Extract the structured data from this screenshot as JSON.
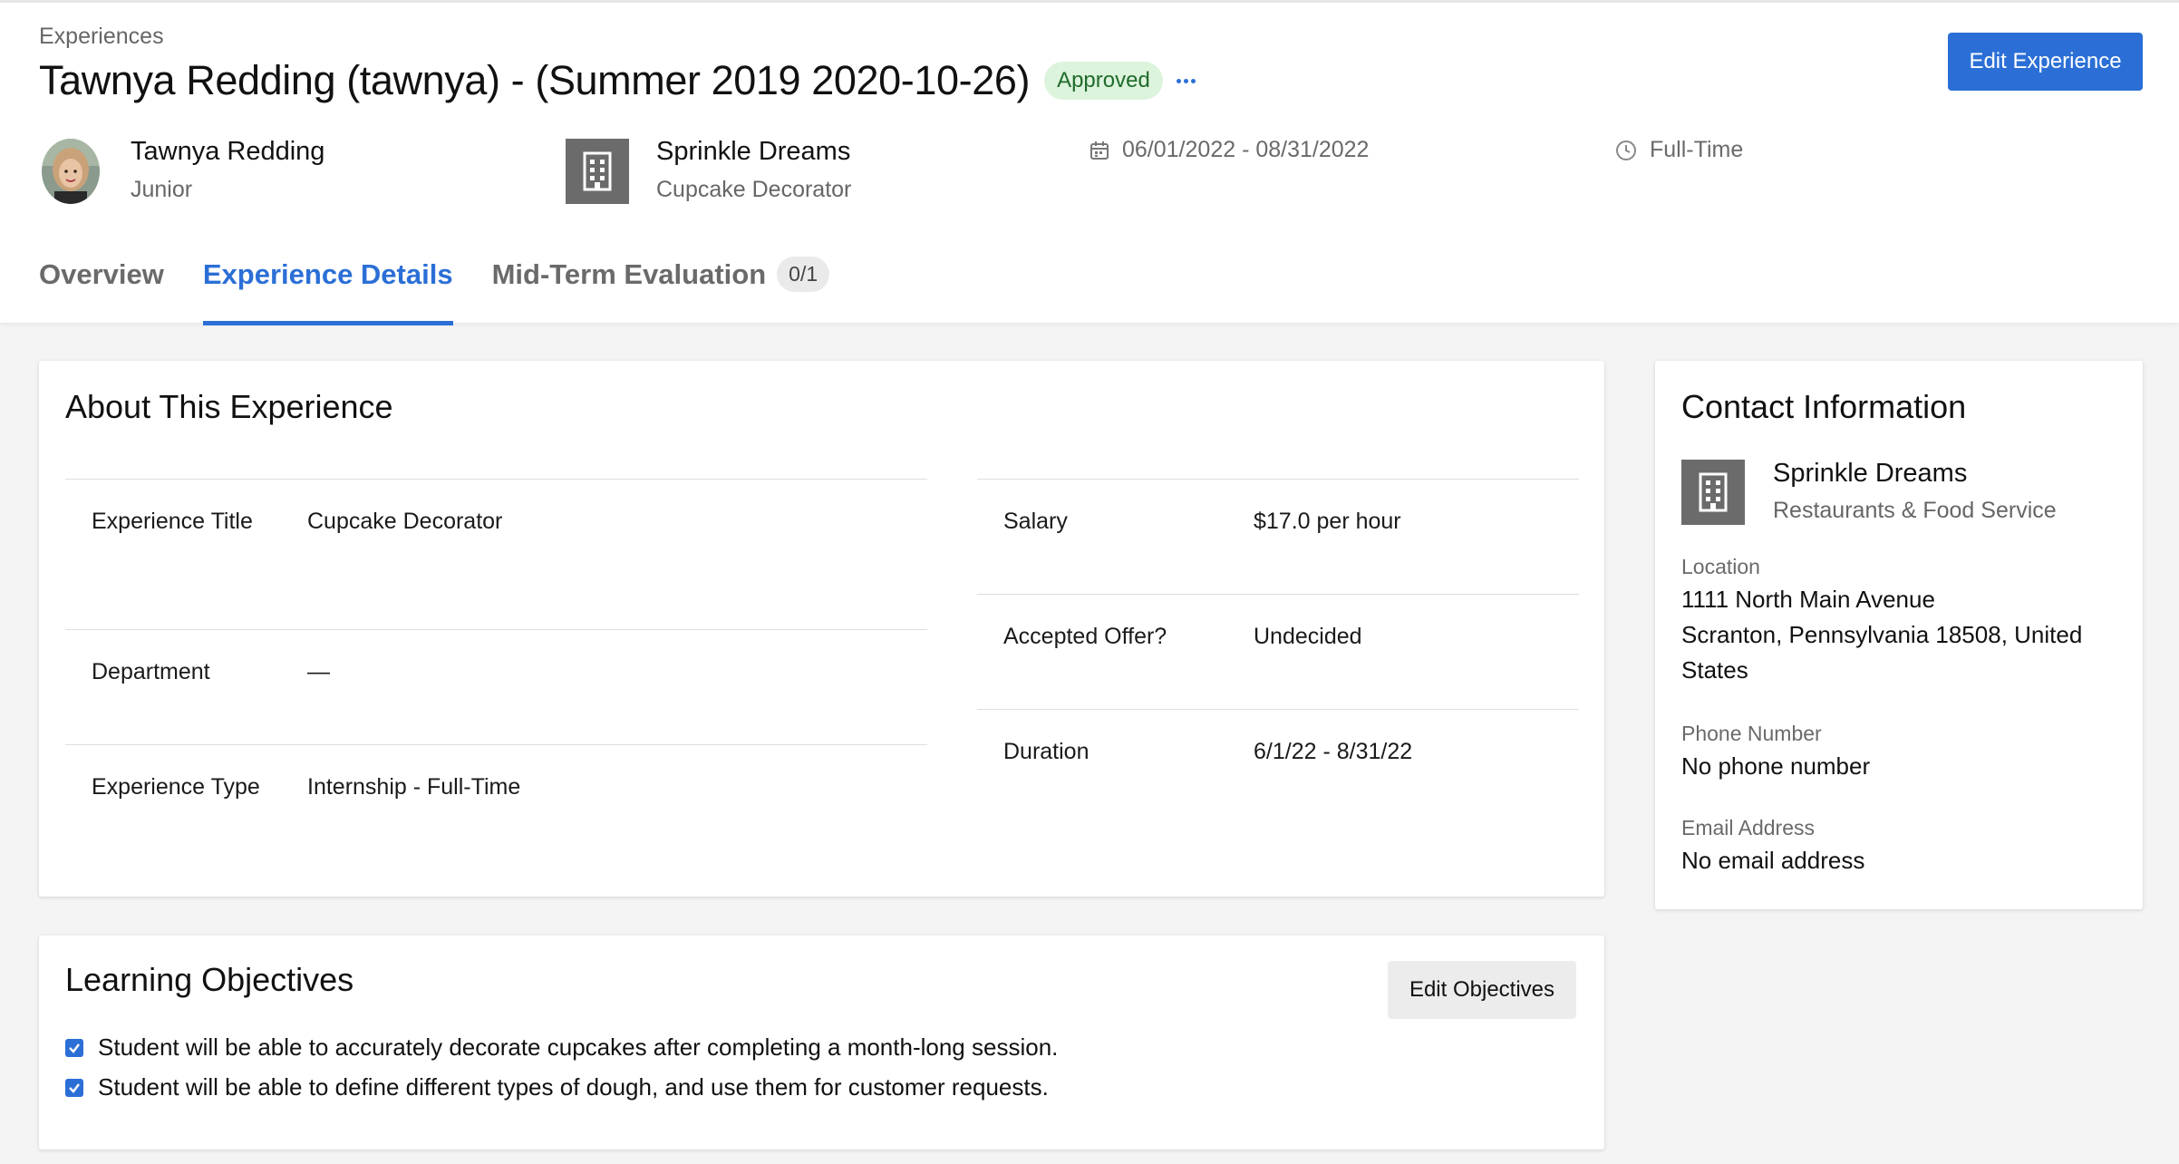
{
  "breadcrumb": "Experiences",
  "title": "Tawnya Redding (tawnya) - (Summer 2019 2020-10-26)",
  "status": "Approved",
  "edit_experience_label": "Edit Experience",
  "student": {
    "name": "Tawnya Redding",
    "year": "Junior"
  },
  "employer": {
    "name": "Sprinkle Dreams",
    "role": "Cupcake Decorator"
  },
  "dates": "06/01/2022 - 08/31/2022",
  "schedule": "Full-Time",
  "tabs": [
    {
      "label": "Overview",
      "active": false
    },
    {
      "label": "Experience Details",
      "active": true
    },
    {
      "label": "Mid-Term Evaluation",
      "count": "0/1",
      "active": false
    }
  ],
  "about": {
    "title": "About This Experience",
    "left": [
      {
        "label": "Experience Title",
        "value": "Cupcake Decorator"
      },
      {
        "label": "Department",
        "value": "—"
      },
      {
        "label": "Experience Type",
        "value": "Internship - Full-Time"
      }
    ],
    "right": [
      {
        "label": "Salary",
        "value": "$17.0 per hour"
      },
      {
        "label": "Accepted Offer?",
        "value": "Undecided"
      },
      {
        "label": "Duration",
        "value": "6/1/22 - 8/31/22"
      }
    ]
  },
  "objectives": {
    "title": "Learning Objectives",
    "edit_label": "Edit Objectives",
    "items": [
      {
        "text": "Student will be able to accurately decorate cupcakes after completing a month-long session.",
        "checked": true
      },
      {
        "text": "Student will be able to define different types of dough, and use them for customer requests.",
        "checked": true
      }
    ]
  },
  "contact": {
    "title": "Contact Information",
    "employer_name": "Sprinkle Dreams",
    "industry": "Restaurants & Food Service",
    "location_label": "Location",
    "address_line1": "1111 North Main Avenue",
    "address_line2": "Scranton, Pennsylvania 18508, United States",
    "phone_label": "Phone Number",
    "phone": "No phone number",
    "email_label": "Email Address",
    "email": "No email address"
  },
  "colors": {
    "accent": "#2b6fd6",
    "approved_bg": "#dcf3dc",
    "approved_text": "#1f6b2b"
  },
  "icons": [
    "more-icon",
    "building-icon",
    "calendar-icon",
    "clock-icon",
    "checkbox-checked-icon"
  ]
}
